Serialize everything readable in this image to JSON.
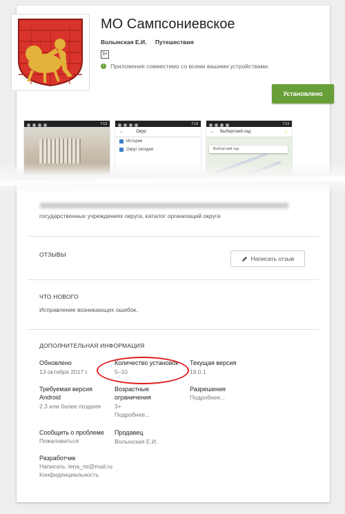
{
  "app": {
    "title": "МО Сампсониевское",
    "developer": "Волынская Е.И.",
    "category": "Путешествия",
    "age_rating": "3+",
    "compat_text": "Приложение совместимо со всеми вашими устройствами.",
    "install_label": "Установлено"
  },
  "screenshots": {
    "s2_title": "Округ",
    "s2_items": [
      "История",
      "Округ сегодня"
    ],
    "s3_title": "Выборгский сад",
    "s3_search": "Выборгский сад",
    "status_time": "7:13"
  },
  "description": "государственных учреждениях округа, каталог организаций округа",
  "reviews": {
    "heading": "ОТЗЫВЫ",
    "write_label": "Написать отзыв"
  },
  "whats_new": {
    "heading": "ЧТО НОВОГО",
    "text": "Исправление возникающих ошибок."
  },
  "additional": {
    "heading": "ДОПОЛНИТЕЛЬНАЯ ИНФОРМАЦИЯ",
    "updated_label": "Обновлено",
    "updated_value": "13 октября 2017 г.",
    "installs_label": "Количество установок",
    "installs_value": "5–10",
    "version_label": "Текущая версия",
    "version_value": "19.0.1",
    "android_label_1": "Требуемая версия",
    "android_label_2": "Android",
    "android_value": "2.3 или более поздняя",
    "age_label_1": "Возрастные",
    "age_label_2": "ограничения",
    "age_value": "3+",
    "age_more": "Подробнее...",
    "perm_label": "Разрешения",
    "perm_more": "Подробнее...",
    "report_label": "Сообщить о проблеме",
    "report_link": "Пожаловаться",
    "seller_label": "Продавец",
    "seller_value": "Волынская Е.И.",
    "dev_label": "Разработчик",
    "dev_email": "Написать: lena_mi@mail.ru",
    "dev_privacy": "Конфиденциальность"
  },
  "colors": {
    "accent": "#689f38",
    "highlight": "#e01b1b"
  },
  "icons": [
    "coat-of-arms-logo",
    "info-icon",
    "pencil-icon",
    "star-icon",
    "back-arrow-icon"
  ]
}
